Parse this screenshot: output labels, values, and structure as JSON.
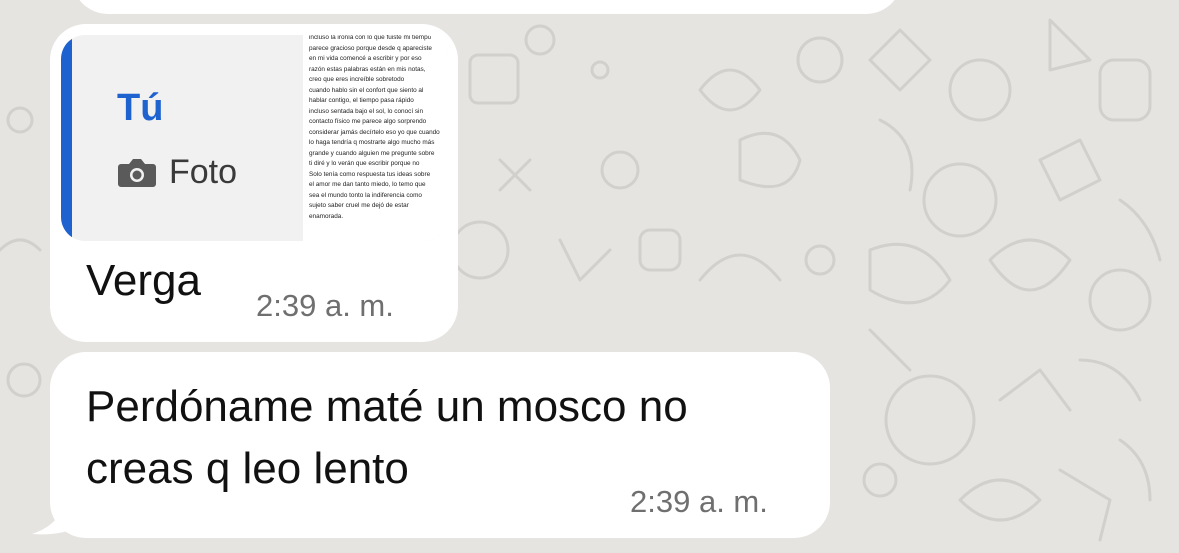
{
  "chat": {
    "messages": [
      {
        "reply": {
          "author": "Tú",
          "type_label": "Foto",
          "type_icon": "camera-icon",
          "thumbnail_text": "incluso la ironía con lo que fuiste mi tiempo\nparece gracioso porque desde q apareciste\nen mi vida comencé a escribir y por eso\nrazón estas palabras están en mis notas,\ncreo que eres increíble sobretodo\ncuando hablo sin el confort que siento al\nhablar contigo, el tiempo pasa rápido\nincluso sentada bajo el sol, lo conocí sin\ncontacto físico me parece algo sorprendo\nconsiderar jamás decírtelo eso yo que cuando\nlo haga tendría q mostrarte algo mucho más\ngrande y cuando alguien me pregunte sobre\nti diré y lo verán que escribir porque no\nSolo tenía como respuesta tus ideas sobre\nel amor me dan tanto miedo, lo temo que\nsea el mundo tonto la indiferencia como\nsujeto saber cruel me dejó de estar\nenamorada."
        },
        "text": "Verga",
        "time": "2:39 a. m."
      },
      {
        "text": "Perdóname maté un mosco no creas q leo lento",
        "time": "2:39 a. m."
      }
    ]
  },
  "colors": {
    "wallpaper": "#e6e4e1",
    "bubble": "#ffffff",
    "reply_accent": "#1e62d0",
    "time": "#6f6f6f"
  }
}
